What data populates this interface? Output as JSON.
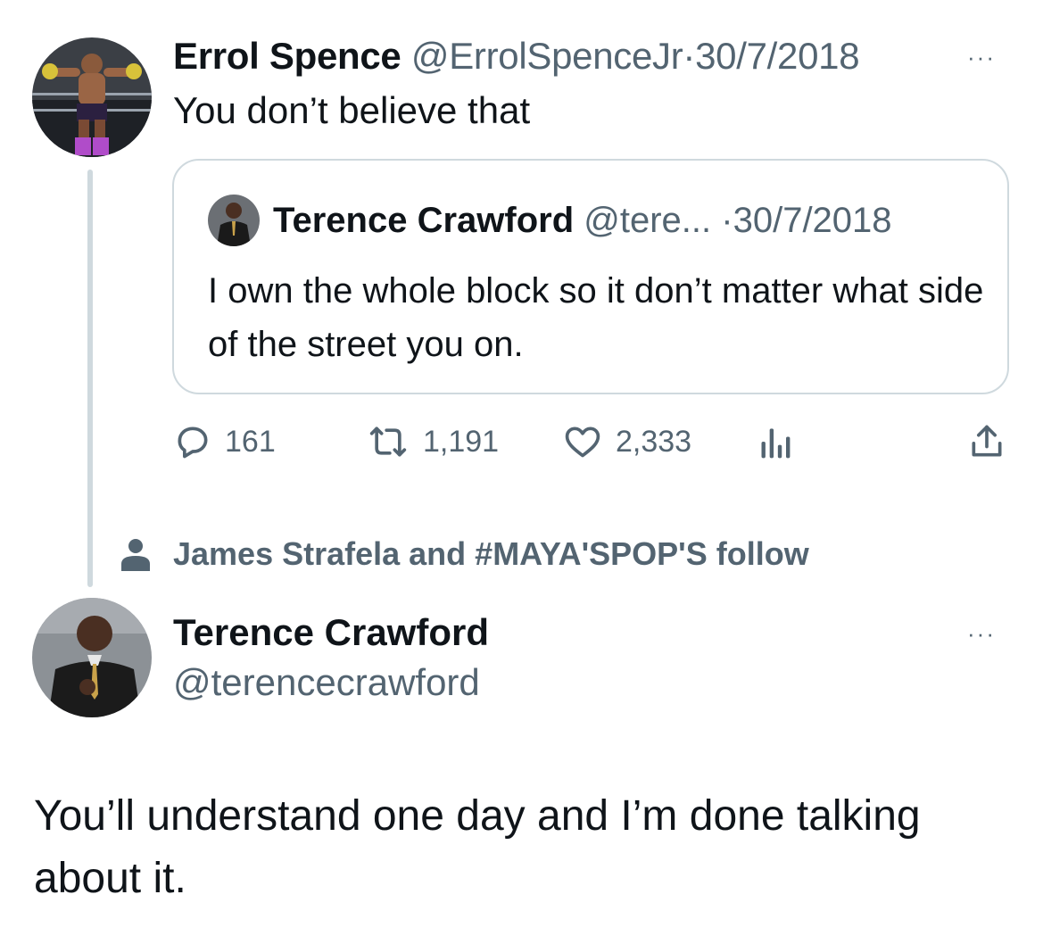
{
  "tweet": {
    "author_name": "Errol Spence",
    "author_handle": "@ErrolSpenceJr",
    "separator": "·",
    "date": "30/7/2018",
    "text": "You don’t believe that",
    "more": "···"
  },
  "quoted_tweet": {
    "author_name": "Terence Crawford",
    "author_handle": "@tere...",
    "separator": "·",
    "date": "30/7/2018",
    "text": "I own the whole block so it don’t matter what side of the street you on."
  },
  "actions": {
    "replies": "161",
    "reposts": "1,191",
    "likes": "2,333"
  },
  "icons": [
    "reply-icon",
    "repost-icon",
    "like-icon",
    "analytics-icon",
    "share-icon",
    "person-icon",
    "more-icon"
  ],
  "follow_context": {
    "text": "James Strafela and #MAYA'SPOP'S follow"
  },
  "reply_tweet": {
    "author_name": "Terence Crawford",
    "author_handle": "@terencecrawford",
    "more": "···",
    "text": "You’ll understand one day and I’m done talking about it."
  },
  "colors": {
    "text_primary": "#0f1419",
    "text_secondary": "#536471",
    "border": "#cfd9de",
    "background": "#ffffff"
  }
}
